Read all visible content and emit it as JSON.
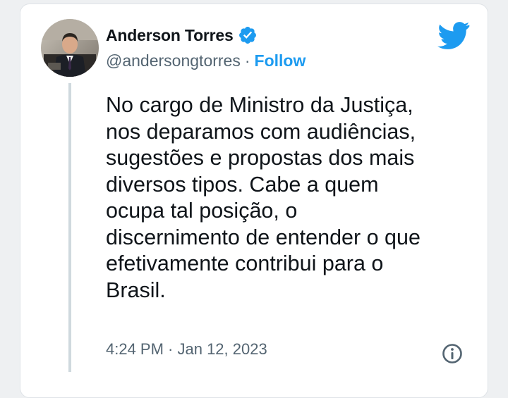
{
  "author": {
    "display_name": "Anderson Torres",
    "handle": "@andersongtorres",
    "separator": "·",
    "follow_label": "Follow"
  },
  "tweet": {
    "text": "No cargo de Ministro da Justiça,\nnos deparamos com audiências,\nsugestões e propostas dos mais\ndiversos tipos. Cabe a quem\nocupa tal posição, o\ndiscernimento de entender o que\nefetivamente contribui para o\nBrasil.",
    "timestamp": "4:24 PM · Jan 12, 2023"
  },
  "icons": {
    "verified": "verified-badge-icon",
    "brand": "twitter-bird-icon",
    "info": "info-icon"
  },
  "colors": {
    "accent": "#1d9bf0",
    "text_primary": "#0f1419",
    "text_secondary": "#536471",
    "thread_line": "#cfd9de"
  }
}
